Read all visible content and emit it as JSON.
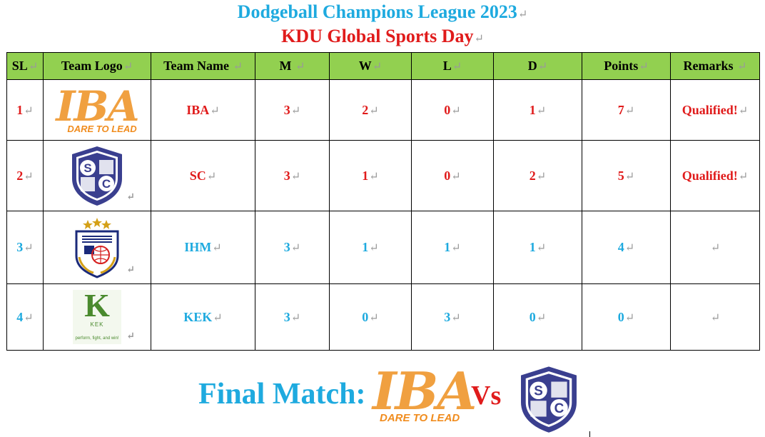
{
  "header": {
    "title": "Dodgeball Champions League 2023",
    "subtitle": "KDU Global Sports Day",
    "mark": "↵"
  },
  "table": {
    "columns": [
      "SL",
      "Team Logo",
      "Team Name",
      "M",
      "W",
      "L",
      "D",
      "Points",
      "Remarks"
    ],
    "rows": [
      {
        "sl": "1",
        "logo": "iba-logo",
        "name": "IBA",
        "m": "3",
        "w": "2",
        "l": "0",
        "d": "1",
        "points": "7",
        "remarks": "Qualified!",
        "color": "#e01b1b"
      },
      {
        "sl": "2",
        "logo": "sc-shield-logo",
        "name": "SC",
        "m": "3",
        "w": "1",
        "l": "0",
        "d": "2",
        "points": "5",
        "remarks": "Qualified!",
        "color": "#e01b1b"
      },
      {
        "sl": "3",
        "logo": "ihm-crest-logo",
        "name": "IHM",
        "m": "3",
        "w": "1",
        "l": "1",
        "d": "1",
        "points": "4",
        "remarks": "",
        "color": "#1eaadf"
      },
      {
        "sl": "4",
        "logo": "kek-logo",
        "name": "KEK",
        "m": "3",
        "w": "0",
        "l": "3",
        "d": "0",
        "points": "0",
        "remarks": "",
        "color": "#1eaadf"
      }
    ]
  },
  "logos": {
    "iba_letters": "IBA",
    "iba_tagline": "DARE TO LEAD",
    "sc_letters": [
      "S",
      "C"
    ],
    "kek_letter": "K",
    "kek_name": "KEK",
    "kek_tagline": "perform, fight, and win!"
  },
  "final_match": {
    "label": "Final Match:",
    "vs": "Vs"
  },
  "colors": {
    "header_bg": "#92d050",
    "accent_blue": "#1eaadf",
    "accent_red": "#e01b1b",
    "iba_orange": "#f0a040",
    "sc_navy": "#3a3f8f"
  }
}
